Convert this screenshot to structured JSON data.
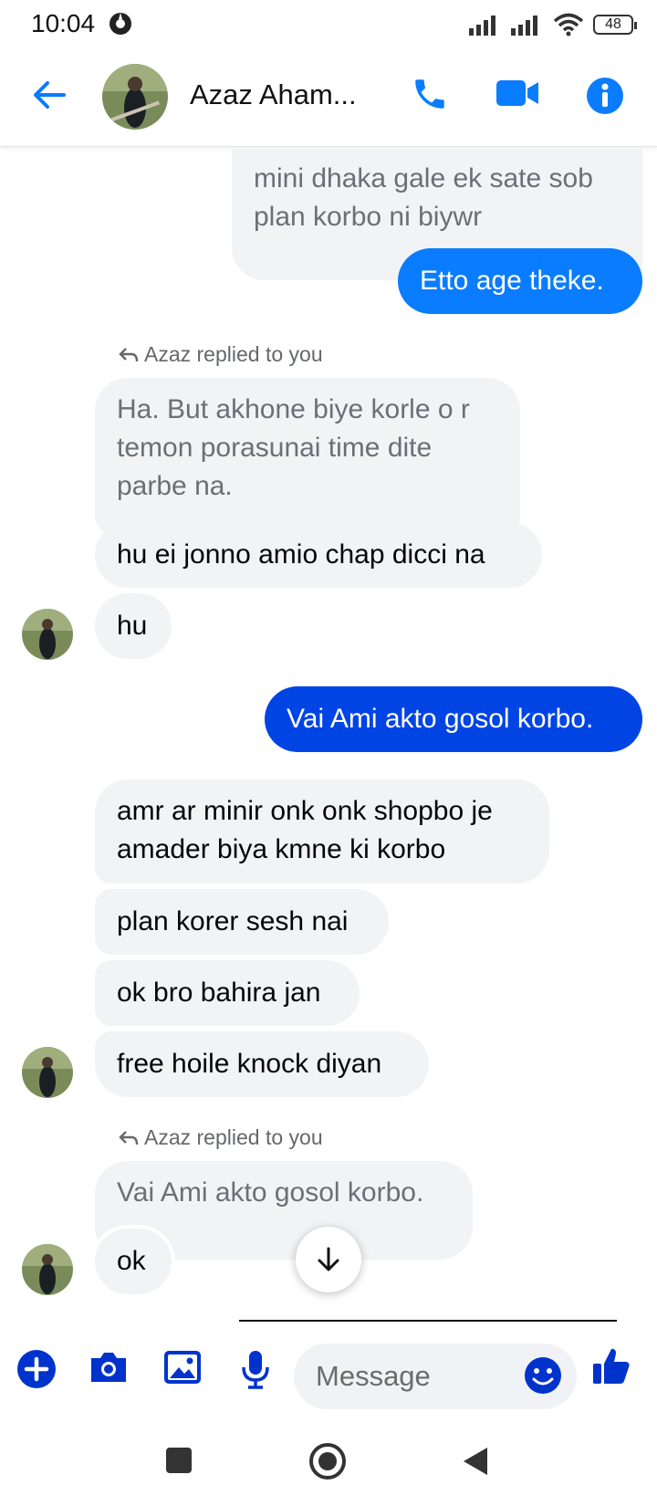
{
  "status_bar": {
    "time": "10:04",
    "battery": "48"
  },
  "header": {
    "contact_name": "Azaz Aham..."
  },
  "messages": {
    "m1": "mini dhaka gale ek sate sob plan korbo ni biywr",
    "m2": "Etto age theke.",
    "reply1_note": "Azaz replied to you",
    "m3_quoted": "Ha. But akhone biye korle o r temon porasunai time dite parbe na.",
    "m4": "hu ei jonno amio chap dicci na",
    "m5": "hu",
    "m6": "Vai Ami akto gosol korbo.",
    "m7": "amr ar minir onk onk shopbo je amader biya kmne ki korbo",
    "m8": "plan korer sesh nai",
    "m9": "ok bro bahira jan",
    "m10": "free hoile knock diyan",
    "reply2_note": "Azaz replied to you",
    "m11_quoted": "Vai Ami akto gosol korbo.",
    "m12": "ok"
  },
  "composer": {
    "placeholder": "Message"
  },
  "colors": {
    "accent": "#0a7cff",
    "sent_dark": "#0044e4",
    "incoming_bg": "#f2f3f5"
  }
}
